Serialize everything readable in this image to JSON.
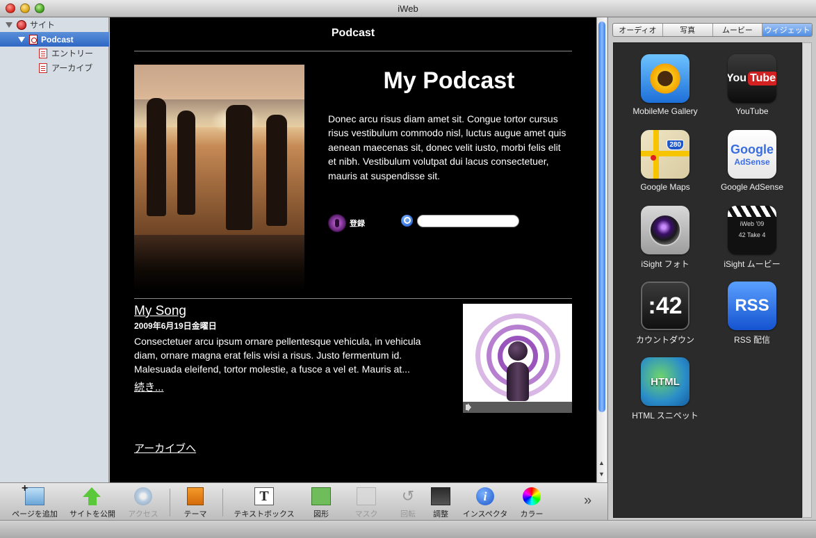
{
  "window": {
    "title": "iWeb"
  },
  "sidebar": {
    "site_label": "サイト",
    "podcast_label": "Podcast",
    "pages": [
      {
        "label": "エントリー"
      },
      {
        "label": "アーカイブ"
      }
    ]
  },
  "canvas": {
    "page_header": "Podcast",
    "main_title": "My Podcast",
    "description": "Donec arcu risus diam amet sit. Congue tortor cursus risus vestibulum commodo nisl, luctus augue amet quis aenean maecenas sit, donec velit iusto, morbi felis elit et nibh. Vestibulum volutpat dui lacus consectetuer, mauris at suspendisse sit.",
    "subscribe_label": "登録",
    "search_value": "",
    "entry": {
      "title": "My Song",
      "date": "2009年6月19日金曜日",
      "body": "Consectetuer arcu ipsum ornare pellentesque vehicula, in vehicula diam, ornare magna erat felis wisi a risus. Justo fermentum id. Malesuada eleifend, tortor molestie, a fusce  a vel et. Mauris at...",
      "read_more": "続き..."
    },
    "archive_link": "アーカイブへ"
  },
  "media_panel": {
    "tabs": [
      {
        "label": "オーディオ",
        "active": false
      },
      {
        "label": "写真",
        "active": false
      },
      {
        "label": "ムービー",
        "active": false
      },
      {
        "label": "ウィジェット",
        "active": true
      }
    ],
    "widgets": [
      {
        "label": "MobileMe Gallery",
        "icon": "sunflower-icon"
      },
      {
        "label": "YouTube",
        "icon": "youtube-icon",
        "tile_text_1": "You",
        "tile_text_2": "Tube"
      },
      {
        "label": "Google Maps",
        "icon": "google-maps-icon",
        "shield": "280"
      },
      {
        "label": "Google AdSense",
        "icon": "google-adsense-icon",
        "tile_text_1": "Google",
        "tile_text_2": "AdSense"
      },
      {
        "label": "iSight フォト",
        "icon": "camera-lens-icon"
      },
      {
        "label": "iSight ムービー",
        "icon": "clapperboard-icon",
        "tile_text_1": "iWeb '09",
        "tile_text_2": "42  Take 4"
      },
      {
        "label": "カウントダウン",
        "icon": "countdown-icon",
        "tile_text_1": ":42"
      },
      {
        "label": "RSS 配信",
        "icon": "rss-icon",
        "tile_text_1": "RSS"
      },
      {
        "label": "HTML スニペット",
        "icon": "html-snippet-icon",
        "tile_text_1": "HTML"
      }
    ]
  },
  "toolbar": {
    "add_page": "ページを追加",
    "publish": "サイトを公開",
    "access": "アクセス",
    "theme": "テーマ",
    "textbox": "テキストボックス",
    "shapes": "図形",
    "mask": "マスク",
    "rotate": "回転",
    "adjust": "調整",
    "inspector": "インスペクタ",
    "colors": "カラー",
    "textbox_glyph": "T",
    "inspector_glyph": "i"
  },
  "colors": {
    "selection_blue": "#2f68c4",
    "canvas_background": "#000000",
    "active_tab": "#4f8ee4"
  }
}
